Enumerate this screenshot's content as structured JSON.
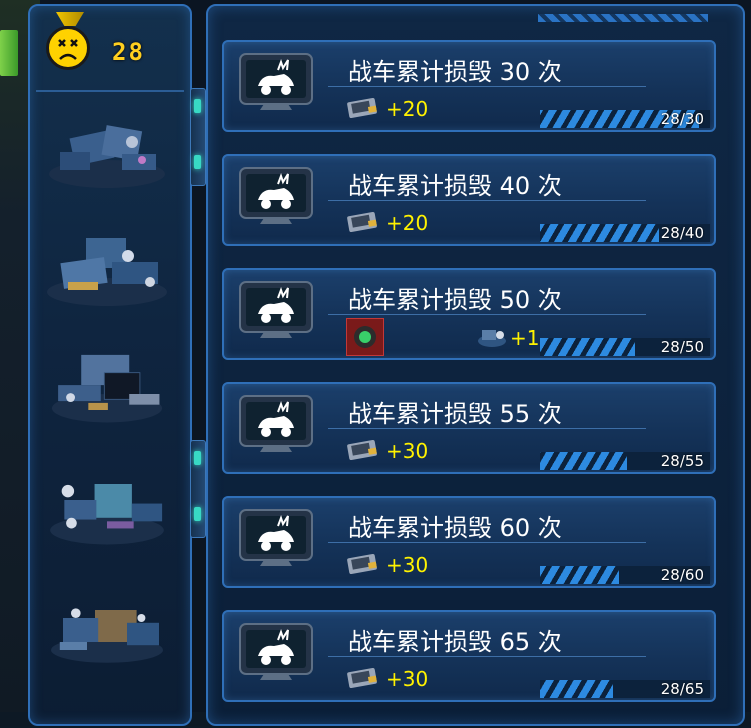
{
  "score": "28",
  "tasks": [
    {
      "title": "战车累计损毁 30 次",
      "reward_type": "chip",
      "reward": "+20",
      "progress_text": "28/30",
      "progress": 0.933
    },
    {
      "title": "战车累计损毁 40 次",
      "reward_type": "chip",
      "reward": "+20",
      "progress_text": "28/40",
      "progress": 0.7
    },
    {
      "title": "战车累计损毁 50 次",
      "reward_type": "item",
      "reward": "+1",
      "progress_text": "28/50",
      "progress": 0.56
    },
    {
      "title": "战车累计损毁 55 次",
      "reward_type": "chip",
      "reward": "+30",
      "progress_text": "28/55",
      "progress": 0.509
    },
    {
      "title": "战车累计损毁 60 次",
      "reward_type": "chip",
      "reward": "+30",
      "progress_text": "28/60",
      "progress": 0.467
    },
    {
      "title": "战车累计损毁 65 次",
      "reward_type": "chip",
      "reward": "+30",
      "progress_text": "28/65",
      "progress": 0.431
    }
  ],
  "colors": {
    "accent": "#2f6fb8",
    "reward": "#fff200",
    "score": "#ffcf1f"
  }
}
